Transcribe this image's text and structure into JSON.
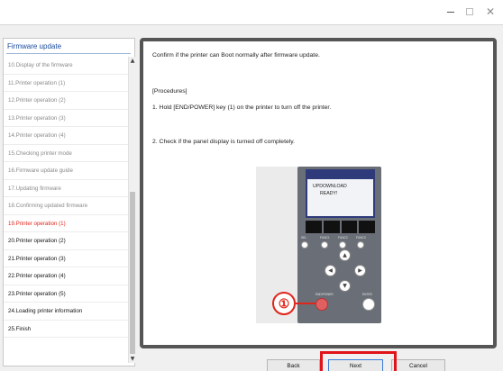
{
  "window": {
    "minimize_icon": "minimize-icon",
    "maximize_icon": "maximize-icon",
    "close_icon": "close-icon",
    "close_glyph": "✕"
  },
  "sidebar": {
    "title": "Firmware update",
    "items": [
      {
        "label": "10.Display of the firmware",
        "state": "done"
      },
      {
        "label": "11.Printer operation (1)",
        "state": "done"
      },
      {
        "label": "12.Printer operation (2)",
        "state": "done"
      },
      {
        "label": "13.Printer operation (3)",
        "state": "done"
      },
      {
        "label": "14.Printer operation (4)",
        "state": "done"
      },
      {
        "label": "15.Checking printer mode",
        "state": "done"
      },
      {
        "label": "16.Firmware update guide",
        "state": "done"
      },
      {
        "label": "17.Updating firmware",
        "state": "done"
      },
      {
        "label": "18.Confirming updated firmware",
        "state": "done"
      },
      {
        "label": "19.Printer operation (1)",
        "state": "current"
      },
      {
        "label": "20.Printer operation (2)",
        "state": "todo"
      },
      {
        "label": "21.Printer operation (3)",
        "state": "todo"
      },
      {
        "label": "22.Printer operation (4)",
        "state": "todo"
      },
      {
        "label": "23.Printer operation (5)",
        "state": "todo"
      },
      {
        "label": "24.Loading printer information",
        "state": "todo"
      },
      {
        "label": "25.Finish",
        "state": "todo"
      }
    ],
    "scroll_up_glyph": "▲",
    "scroll_down_glyph": "▼"
  },
  "content": {
    "intro": "Confirm if the printer can Boot normally after firmware update.",
    "procedures_heading": "[Procedures]",
    "step1": "1.  Hold [END/POWER] key (1) on the printer to turn off the printer.",
    "step2": "2.  Check if the panel display is turned off completely."
  },
  "printer_image": {
    "lcd_line1": "UPDOWNLOAD",
    "lcd_line2": "READY!",
    "sel_label": "SEL",
    "func1_label": "FUNC1",
    "func2_label": "FUNC2",
    "func3_label": "FUNC3",
    "end_label": "END/POWER",
    "enter_label": "ENTER",
    "callout_number": "①",
    "arrow_up": "▲",
    "arrow_down": "▼",
    "arrow_left": "◀",
    "arrow_right": "▶"
  },
  "buttons": {
    "back": "Back",
    "next": "Next",
    "cancel": "Cancel"
  },
  "colors": {
    "current_step": "#e0251b",
    "sidebar_title": "#1a4a9c",
    "highlight": "#e0141a"
  }
}
